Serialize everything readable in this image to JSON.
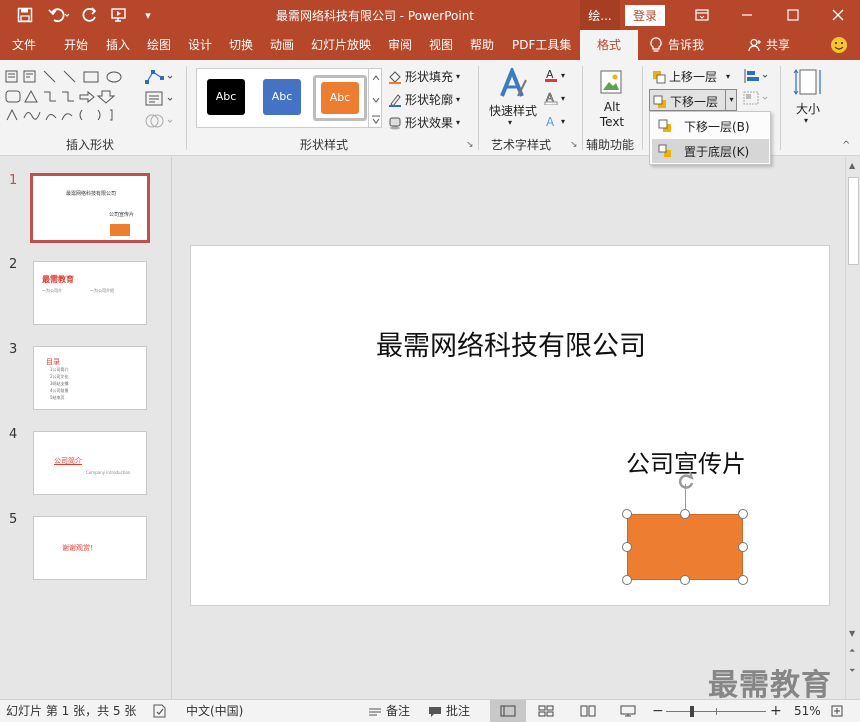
{
  "titlebar": {
    "title": "最需网络科技有限公司  -  PowerPoint",
    "context_tab": "绘...",
    "login_label": "登录",
    "quick_access_more": "▾"
  },
  "tabs": [
    {
      "label": "文件"
    },
    {
      "label": "开始"
    },
    {
      "label": "插入"
    },
    {
      "label": "绘图"
    },
    {
      "label": "设计"
    },
    {
      "label": "切换"
    },
    {
      "label": "动画"
    },
    {
      "label": "幻灯片放映"
    },
    {
      "label": "审阅"
    },
    {
      "label": "视图"
    },
    {
      "label": "帮助"
    },
    {
      "label": "PDF工具集"
    },
    {
      "label": "格式",
      "active": true
    }
  ],
  "tellme": "告诉我",
  "share": "共享",
  "ribbon": {
    "insert_shapes_label": "插入形状",
    "shape_styles_label": "形状样式",
    "style_swatches": [
      {
        "text": "Abc",
        "color": "#000000"
      },
      {
        "text": "Abc",
        "color": "#4472c4"
      },
      {
        "text": "Abc",
        "color": "#ed7d31"
      }
    ],
    "shape_fill": "形状填充",
    "shape_outline": "形状轮廓",
    "shape_effects": "形状效果",
    "quick_styles": "快速样式",
    "wordart_label": "艺术字样式",
    "alt_text_line1": "Alt",
    "alt_text_line2": "Text",
    "accessibility_label": "辅助功能",
    "bring_forward": "上移一层",
    "send_backward": "下移一层",
    "size_label": "大小"
  },
  "dropdown": {
    "items": [
      {
        "label": "下移一层(B)"
      },
      {
        "label": "置于底层(K)",
        "highlighted": true
      }
    ]
  },
  "slides": [
    {
      "number": "1",
      "title": "最需网络科技有限公司",
      "subtitle": "公司宣传片"
    },
    {
      "number": "2",
      "title": "最需教育",
      "col1": "一为公司介",
      "col2": "一为公司介绍"
    },
    {
      "number": "3",
      "title": "目录",
      "items": [
        "1公司简介",
        "2公司文化",
        "3网站支撑",
        "4公司前景",
        "5结束页"
      ]
    },
    {
      "number": "4",
      "title": "公司简介",
      "subtitle": "Company introduction"
    },
    {
      "number": "5",
      "title": "谢谢观赏！"
    }
  ],
  "slide": {
    "title": "最需网络科技有限公司",
    "subtitle": "公司宣传片",
    "rect_color": "#ed7d31"
  },
  "status": {
    "slide_info": "幻灯片 第 1 张，共 5 张",
    "language": "中文(中国)",
    "notes": "备注",
    "comments": "批注",
    "zoom": "51%"
  },
  "watermark": "最需教育"
}
